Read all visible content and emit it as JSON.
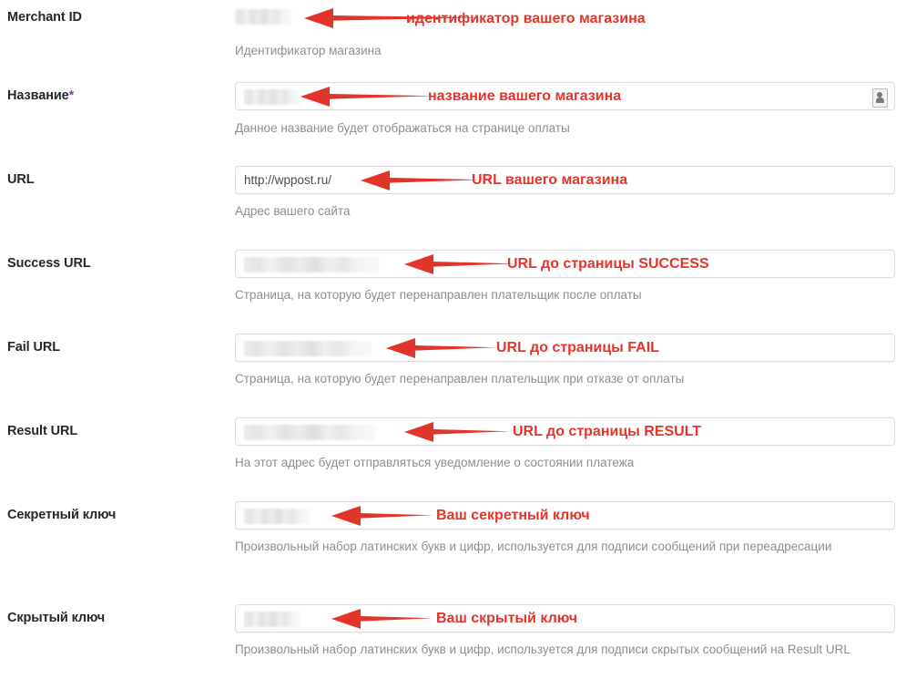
{
  "theme": {
    "annotation_color": "#e5342a",
    "label_color": "#23282d",
    "help_color": "#8e8e8e",
    "required_marker_color": "#8c3fa0",
    "field_border_color": "#dddddd",
    "background": "#ffffff"
  },
  "fields": [
    {
      "id": "merchant-id",
      "label": "Merchant ID",
      "required": false,
      "boxed": false,
      "value_redacted": true,
      "value": "",
      "help": "Идентификатор магазина",
      "annotation": "идентификатор вашего магазина",
      "has_autofill_icon": false
    },
    {
      "id": "name",
      "label": "Название",
      "required": true,
      "required_marker": "*",
      "boxed": true,
      "value_redacted": true,
      "value": "",
      "help": "Данное название будет отображаться на странице оплаты",
      "annotation": "название вашего магазина",
      "has_autofill_icon": true
    },
    {
      "id": "url",
      "label": "URL",
      "required": false,
      "boxed": true,
      "value_redacted": false,
      "value": "http://wppost.ru/",
      "help": "Адрес вашего сайта",
      "annotation": "URL вашего магазина",
      "has_autofill_icon": false
    },
    {
      "id": "success-url",
      "label": "Success URL",
      "required": false,
      "boxed": true,
      "value_redacted": true,
      "value": "",
      "help": "Страница, на которую будет перенаправлен плательщик после оплаты",
      "annotation": "URL до страницы SUCCESS",
      "has_autofill_icon": false
    },
    {
      "id": "fail-url",
      "label": "Fail URL",
      "required": false,
      "boxed": true,
      "value_redacted": true,
      "value": "",
      "help": "Страница, на которую будет перенаправлен плательщик при отказе от оплаты",
      "annotation": "URL до страницы FAIL",
      "has_autofill_icon": false
    },
    {
      "id": "result-url",
      "label": "Result URL",
      "required": false,
      "boxed": true,
      "value_redacted": true,
      "value": "",
      "help": "На этот адрес будет отправляться уведомление о состоянии платежа",
      "annotation": "URL до страницы RESULT",
      "has_autofill_icon": false
    },
    {
      "id": "secret-key",
      "label": "Секретный ключ",
      "required": false,
      "boxed": true,
      "value_redacted": true,
      "value": "",
      "help": "Произвольный набор латинских букв и цифр, используется для подписи сообщений при переадресации",
      "annotation": "Ваш секретный ключ",
      "has_autofill_icon": false
    },
    {
      "id": "hidden-key",
      "label": "Скрытый ключ",
      "required": false,
      "boxed": true,
      "value_redacted": true,
      "value": "",
      "help": "Произвольный набор латинских букв и цифр, используется для подписи скрытых сообщений на Result URL",
      "annotation": "Ваш скрытый ключ",
      "has_autofill_icon": false
    }
  ],
  "icons": {
    "autofill": "autofill-credentials-icon",
    "arrow": "arrow-left-pointer"
  }
}
